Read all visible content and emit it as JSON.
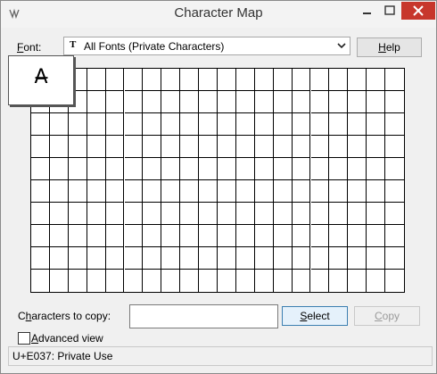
{
  "window": {
    "title": "Character Map",
    "close_color": "#c7372c"
  },
  "toolbar": {
    "font_label_prefix": "",
    "font_label_hotkey": "F",
    "font_label_rest": "ont:",
    "font_value": "All Fonts (Private Characters)",
    "help_hotkey": "H",
    "help_rest": "elp"
  },
  "grid": {
    "columns": 20,
    "rows": 10,
    "zoom_char": "A̶"
  },
  "copy": {
    "label_pre": "C",
    "label_hotkey": "h",
    "label_rest": "aracters to copy:",
    "value": "",
    "select_hotkey": "S",
    "select_rest": "elect",
    "copy_hotkey": "C",
    "copy_rest": "opy"
  },
  "advanced": {
    "hotkey": "A",
    "rest": "dvanced view",
    "checked": false
  },
  "status": "U+E037: Private Use"
}
